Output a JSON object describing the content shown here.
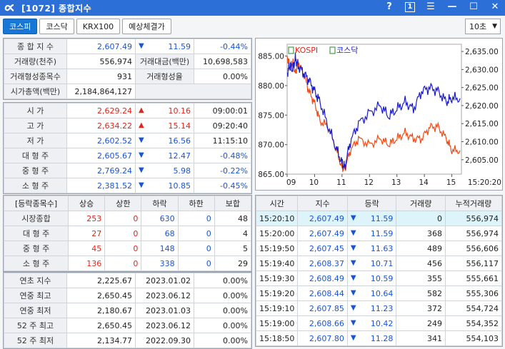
{
  "window": {
    "title": "[1072] 종합지수",
    "help": "?",
    "num_btn": "1"
  },
  "tabs": [
    "코스피",
    "코스닥",
    "KRX100",
    "예상체결가"
  ],
  "interval": "10초",
  "summary": {
    "index_label": "종 합 지 수",
    "index_value": "2,607.49",
    "index_change": "11.59",
    "index_pct": "-0.44%",
    "vol_label": "거래량(천주)",
    "vol_value": "556,974",
    "amt_label": "거래대금(백만)",
    "amt_value": "10,698,583",
    "formed_cnt_label": "거래형성종목수",
    "formed_cnt_value": "931",
    "formed_rate_label": "거래형성율",
    "formed_rate_value": "0.00%",
    "mcap_label": "시가총액(백만)",
    "mcap_value": "2,184,864,127"
  },
  "ohlc": [
    {
      "label": "시 가",
      "value": "2,629.24",
      "dir": "up",
      "change": "10.16",
      "extra": "09:00:01"
    },
    {
      "label": "고 가",
      "value": "2,634.22",
      "dir": "up",
      "change": "15.14",
      "extra": "09:20:40"
    },
    {
      "label": "저 가",
      "value": "2,602.52",
      "dir": "down",
      "change": "16.56",
      "extra": "11:15:10"
    },
    {
      "label": "대 형 주",
      "value": "2,605.67",
      "dir": "down",
      "change": "12.47",
      "extra": "-0.48%"
    },
    {
      "label": "중 형 주",
      "value": "2,769.24",
      "dir": "down",
      "change": "5.98",
      "extra": "-0.22%"
    },
    {
      "label": "소 형 주",
      "value": "2,381.52",
      "dir": "down",
      "change": "10.85",
      "extra": "-0.45%"
    }
  ],
  "updown": {
    "headers": [
      "[등락종목수]",
      "상승",
      "상한",
      "하락",
      "하한",
      "보합"
    ],
    "rows": [
      {
        "label": "시장종합",
        "up": "253",
        "limup": "0",
        "down": "630",
        "limdown": "0",
        "flat": "48"
      },
      {
        "label": "대 형 주",
        "up": "27",
        "limup": "0",
        "down": "68",
        "limdown": "0",
        "flat": "4"
      },
      {
        "label": "중 형 주",
        "up": "45",
        "limup": "0",
        "down": "148",
        "limdown": "0",
        "flat": "5"
      },
      {
        "label": "소 형 주",
        "up": "136",
        "limup": "0",
        "down": "338",
        "limdown": "0",
        "flat": "29"
      }
    ]
  },
  "yearly": [
    {
      "label": "연초 지수",
      "value": "2,225.67",
      "date": "2023.01.02",
      "pct": "0.00%"
    },
    {
      "label": "연중 최고",
      "value": "2,650.45",
      "date": "2023.06.12",
      "pct": "0.00%"
    },
    {
      "label": "연중 최저",
      "value": "2,180.67",
      "date": "2023.01.03",
      "pct": "0.00%"
    },
    {
      "label": "52 주 최고",
      "value": "2,650.45",
      "date": "2023.06.12",
      "pct": "0.00%"
    },
    {
      "label": "52 주 최저",
      "value": "2,134.77",
      "date": "2022.09.30",
      "pct": "0.00%"
    }
  ],
  "ticks": {
    "headers": [
      "시간",
      "지수",
      "등락",
      "거래량",
      "누적거래량"
    ],
    "rows": [
      {
        "time": "15:20:10",
        "index": "2,607.49",
        "change": "11.59",
        "vol": "0",
        "cum": "556,974"
      },
      {
        "time": "15:20:00",
        "index": "2,607.49",
        "change": "11.59",
        "vol": "368",
        "cum": "556,974"
      },
      {
        "time": "15:19:50",
        "index": "2,607.45",
        "change": "11.63",
        "vol": "489",
        "cum": "556,606"
      },
      {
        "time": "15:19:40",
        "index": "2,608.37",
        "change": "10.71",
        "vol": "456",
        "cum": "556,117"
      },
      {
        "time": "15:19:30",
        "index": "2,608.49",
        "change": "10.59",
        "vol": "355",
        "cum": "555,661"
      },
      {
        "time": "15:19:20",
        "index": "2,608.44",
        "change": "10.64",
        "vol": "582",
        "cum": "555,306"
      },
      {
        "time": "15:19:10",
        "index": "2,607.85",
        "change": "11.23",
        "vol": "372",
        "cum": "554,724"
      },
      {
        "time": "15:19:00",
        "index": "2,608.66",
        "change": "10.42",
        "vol": "249",
        "cum": "554,352"
      },
      {
        "time": "15:18:50",
        "index": "2,607.80",
        "change": "11.28",
        "vol": "341",
        "cum": "554,103"
      }
    ]
  },
  "chart_data": {
    "type": "line",
    "legend": [
      "KOSPI",
      "코스닥"
    ],
    "x_ticks": [
      "09",
      "10",
      "11",
      "12",
      "13",
      "14",
      "15"
    ],
    "end_time": "15:20:20",
    "left_axis": {
      "ticks": [
        "885.00",
        "880.00",
        "875.00",
        "870.00",
        "865.00"
      ],
      "ylim": [
        865,
        887
      ]
    },
    "right_axis": {
      "ticks": [
        "2,635.00",
        "2,630.00",
        "2,625.00",
        "2,620.00",
        "2,615.00",
        "2,610.00",
        "2,605.00"
      ],
      "ylim": [
        2601,
        2637
      ]
    },
    "x_range": [
      9.0,
      15.35
    ],
    "series": [
      {
        "name": "KOSPI",
        "color": "#1a1acb",
        "axis": "right",
        "x": [
          9.0,
          9.1,
          9.2,
          9.3,
          9.4,
          9.6,
          9.8,
          10.0,
          10.2,
          10.5,
          10.8,
          11.0,
          11.1,
          11.3,
          11.6,
          12.0,
          12.4,
          12.7,
          13.0,
          13.3,
          13.6,
          13.9,
          14.2,
          14.5,
          14.8,
          15.0,
          15.3
        ],
        "y": [
          2629,
          2631,
          2630,
          2633,
          2631,
          2629,
          2627,
          2624,
          2621,
          2614,
          2608,
          2604,
          2603,
          2610,
          2615,
          2618,
          2620,
          2617,
          2619,
          2621,
          2619,
          2624,
          2625,
          2624,
          2621,
          2622,
          2622
        ]
      },
      {
        "name": "코스닥",
        "color": "#f04a14",
        "axis": "left",
        "x": [
          9.0,
          9.1,
          9.2,
          9.3,
          9.4,
          9.6,
          9.8,
          10.0,
          10.2,
          10.5,
          10.8,
          11.0,
          11.1,
          11.3,
          11.6,
          12.0,
          12.4,
          12.7,
          13.0,
          13.3,
          13.6,
          13.9,
          14.2,
          14.5,
          14.8,
          15.0,
          15.3
        ],
        "y": [
          885,
          883,
          884,
          882,
          884,
          882,
          879,
          877,
          874,
          873,
          869,
          866,
          866,
          869,
          871,
          870,
          871,
          870,
          871,
          872,
          871,
          871,
          873,
          873,
          871,
          869,
          869
        ]
      }
    ]
  }
}
